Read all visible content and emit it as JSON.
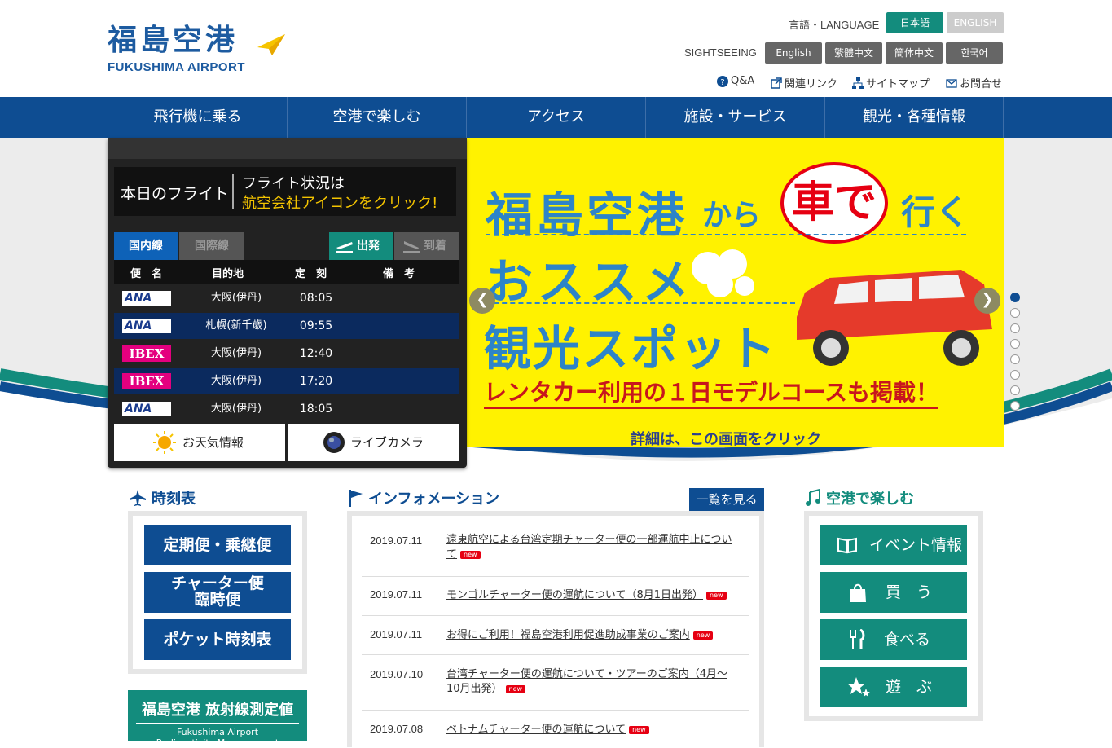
{
  "header": {
    "logo_jp": "福島空港",
    "logo_en": "FUKUSHIMA AIRPORT",
    "language_label": "言語・LANGUAGE",
    "lang_jp": "日本語",
    "lang_en": "ENGLISH",
    "sightseeing_label": "SIGHTSEEING",
    "sight_langs": [
      "English",
      "繁體中文",
      "簡体中文",
      "한국어"
    ],
    "util_links": [
      "Q&A",
      "関連リンク",
      "サイトマップ",
      "お問合せ"
    ]
  },
  "nav": [
    "飛行機に乗る",
    "空港で楽しむ",
    "アクセス",
    "施設・サービス",
    "観光・各種情報"
  ],
  "flight_board": {
    "title": "本日のフライト",
    "note_line1": "フライト状況は",
    "note_line2": "航空会社アイコンをクリック!",
    "tab_domestic": "国内線",
    "tab_international": "国際線",
    "tab_departure": "出発",
    "tab_arrival": "到着",
    "columns": [
      "便　名",
      "目的地",
      "定　刻",
      "備　考"
    ],
    "rows": [
      {
        "airline": "ANA",
        "destination": "大阪(伊丹)",
        "time": "08:05"
      },
      {
        "airline": "ANA",
        "destination": "札幌(新千歳)",
        "time": "09:55"
      },
      {
        "airline": "IBEX",
        "destination": "大阪(伊丹)",
        "time": "12:40"
      },
      {
        "airline": "IBEX",
        "destination": "大阪(伊丹)",
        "time": "17:20"
      },
      {
        "airline": "ANA",
        "destination": "大阪(伊丹)",
        "time": "18:05"
      }
    ],
    "weather": "お天気情報",
    "livecam": "ライブカメラ"
  },
  "slide": {
    "line1": "福島空港",
    "line1_small": "から",
    "bubble": "車で",
    "line1_end": "行く",
    "line2": "おススメ",
    "line3": "観光スポット",
    "banner": "レンタカー利用の１日モデルコースも掲載！",
    "detail": "詳細は、この画面をクリック"
  },
  "timetable": {
    "heading": "時刻表",
    "buttons": [
      "定期便・乗継便",
      "チャーター便",
      "臨時便",
      "ポケット時刻表"
    ]
  },
  "radiation": {
    "title": "福島空港 放射線測定値",
    "subtitle": "Fukushima Airport",
    "subtitle2": "Radioactivity Measurement"
  },
  "info": {
    "heading": "インフォメーション",
    "more": "一覧を見る",
    "new_label": "new",
    "items": [
      {
        "date": "2019.07.11",
        "title": "遠東航空による台湾定期チャーター便の一部運航中止について"
      },
      {
        "date": "2019.07.11",
        "title": "モンゴルチャーター便の運航について（8月1日出発）"
      },
      {
        "date": "2019.07.11",
        "title": "お得にご利用！福島空港利用促進助成事業のご案内"
      },
      {
        "date": "2019.07.10",
        "title": "台湾チャーター便の運航について・ツアーのご案内（4月～10月出発）"
      },
      {
        "date": "2019.07.08",
        "title": "ベトナムチャーター便の運航について"
      }
    ]
  },
  "enjoy": {
    "heading": "空港で楽しむ",
    "buttons": [
      "イベント情報",
      "買　う",
      "食べる",
      "遊　ぶ"
    ]
  }
}
